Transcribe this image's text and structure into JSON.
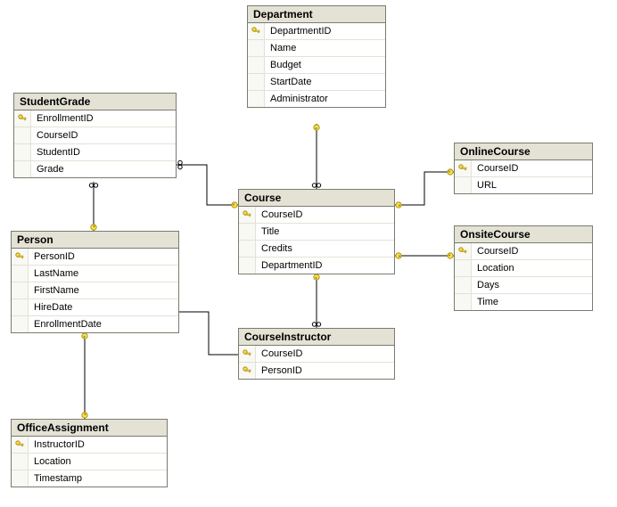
{
  "tables": {
    "studentGrade": {
      "title": "StudentGrade",
      "cols": [
        "EnrollmentID",
        "CourseID",
        "StudentID",
        "Grade"
      ]
    },
    "department": {
      "title": "Department",
      "cols": [
        "DepartmentID",
        "Name",
        "Budget",
        "StartDate",
        "Administrator"
      ]
    },
    "person": {
      "title": "Person",
      "cols": [
        "PersonID",
        "LastName",
        "FirstName",
        "HireDate",
        "EnrollmentDate"
      ]
    },
    "course": {
      "title": "Course",
      "cols": [
        "CourseID",
        "Title",
        "Credits",
        "DepartmentID"
      ]
    },
    "onlineCourse": {
      "title": "OnlineCourse",
      "cols": [
        "CourseID",
        "URL"
      ]
    },
    "onsiteCourse": {
      "title": "OnsiteCourse",
      "cols": [
        "CourseID",
        "Location",
        "Days",
        "Time"
      ]
    },
    "courseInstructor": {
      "title": "CourseInstructor",
      "cols": [
        "CourseID",
        "PersonID"
      ]
    },
    "officeAssignment": {
      "title": "OfficeAssignment",
      "cols": [
        "InstructorID",
        "Location",
        "Timestamp"
      ]
    }
  },
  "relations": [
    {
      "from": "StudentGrade",
      "to": "Course",
      "type": "many-to-one"
    },
    {
      "from": "StudentGrade",
      "to": "Person",
      "type": "many-to-one"
    },
    {
      "from": "Course",
      "to": "Department",
      "type": "many-to-one"
    },
    {
      "from": "OnlineCourse",
      "to": "Course",
      "type": "one-to-one"
    },
    {
      "from": "OnsiteCourse",
      "to": "Course",
      "type": "one-to-one"
    },
    {
      "from": "CourseInstructor",
      "to": "Course",
      "type": "many-to-one"
    },
    {
      "from": "CourseInstructor",
      "to": "Person",
      "type": "many-to-one"
    },
    {
      "from": "OfficeAssignment",
      "to": "Person",
      "type": "one-to-one"
    }
  ]
}
